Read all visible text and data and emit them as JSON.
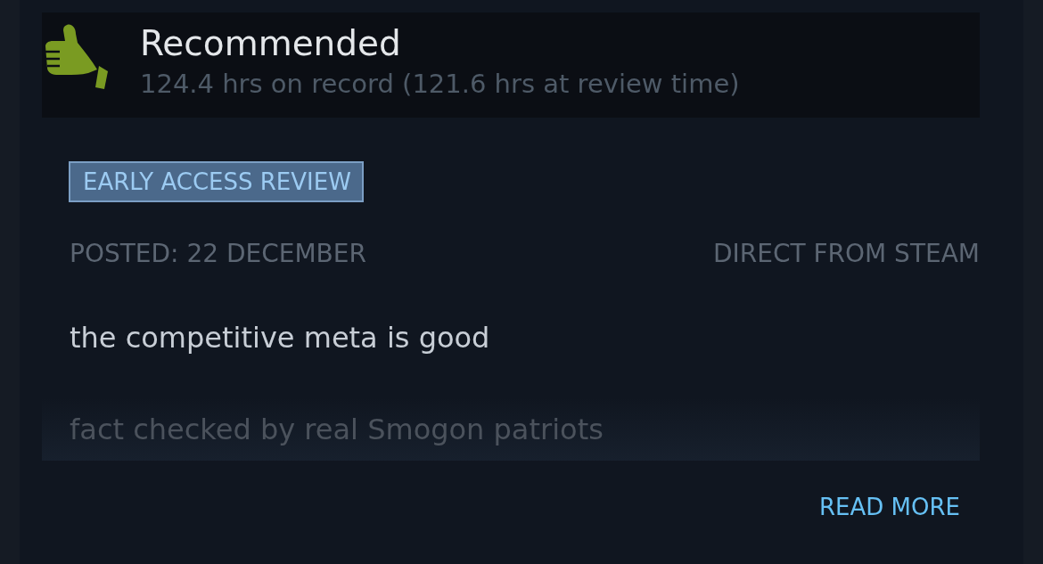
{
  "review": {
    "verdict": "Recommended",
    "hours": "124.4 hrs on record (121.6 hrs at review time)",
    "badge": "EARLY ACCESS REVIEW",
    "posted": "POSTED: 22 DECEMBER",
    "source": "DIRECT FROM STEAM",
    "paragraphs": [
      "the competitive meta is good",
      "fact checked by real Smogon patriots"
    ],
    "read_more": "READ MORE"
  }
}
